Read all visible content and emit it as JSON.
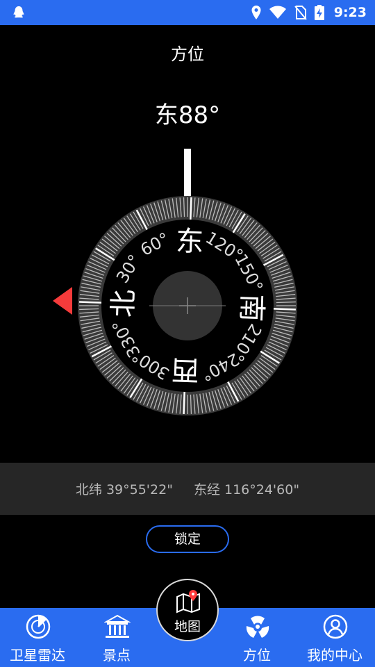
{
  "status_bar": {
    "time": "9:23",
    "icons": [
      "qq-icon",
      "location-icon",
      "wifi-icon",
      "no-sim-icon",
      "battery-charging-icon"
    ]
  },
  "page": {
    "title": "方位",
    "heading_reading": "东88°"
  },
  "compass": {
    "heading_degrees": 88,
    "cardinals": [
      "北",
      "东",
      "南",
      "西"
    ],
    "degree_labels": [
      "30°",
      "60°",
      "120°",
      "150°",
      "210°",
      "240°",
      "300°",
      "330°"
    ],
    "pointer_color": "#f53b3b"
  },
  "coordinates": {
    "latitude": "北纬 39°55'22\"",
    "longitude": "东经 116°24'60\""
  },
  "lock_button": {
    "label": "锁定"
  },
  "tabs": [
    {
      "label": "卫星雷达",
      "icon": "radar-icon"
    },
    {
      "label": "景点",
      "icon": "landmark-icon"
    },
    {
      "label": "地图",
      "icon": "map-pin-icon"
    },
    {
      "label": "方位",
      "icon": "compass-rose-icon"
    },
    {
      "label": "我的中心",
      "icon": "user-icon"
    }
  ],
  "colors": {
    "accent": "#2a6cf0",
    "background": "#000000",
    "coord_bar": "#262626"
  }
}
